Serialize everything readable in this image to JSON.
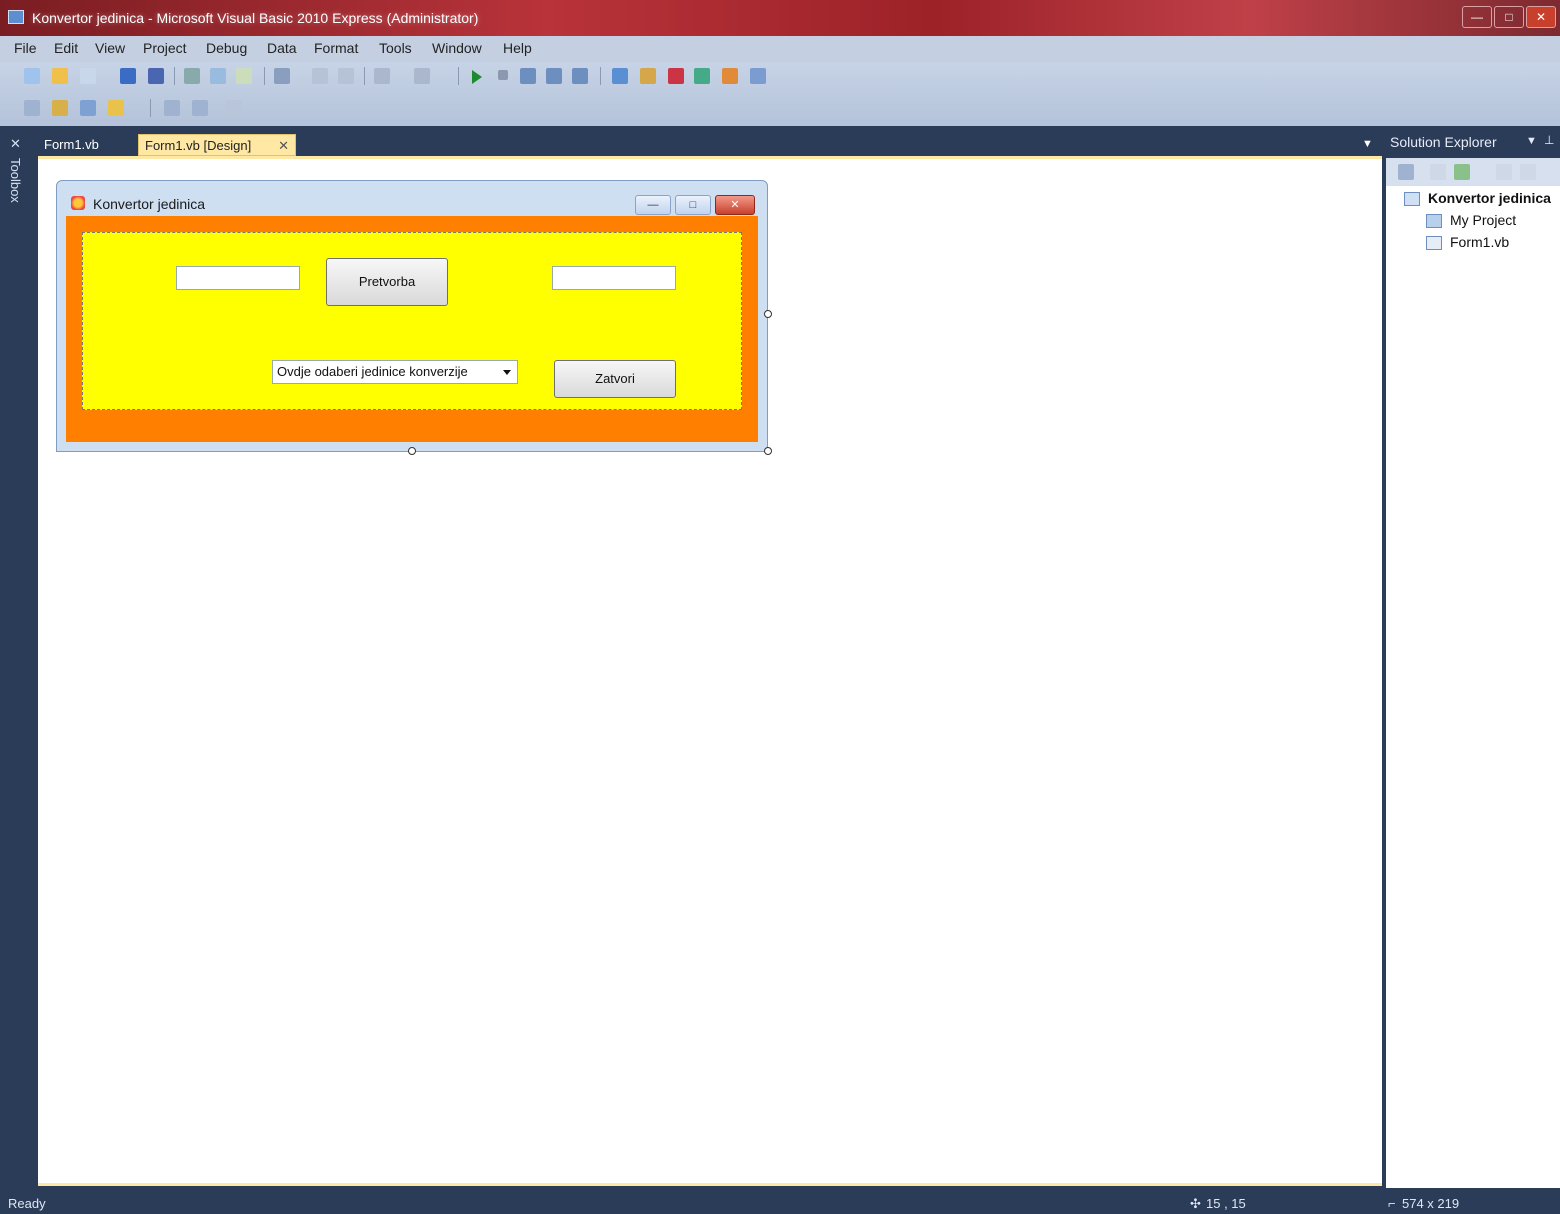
{
  "window": {
    "title": "Konvertor jedinica - Microsoft Visual Basic 2010 Express (Administrator)"
  },
  "menu": [
    "File",
    "Edit",
    "View",
    "Project",
    "Debug",
    "Data",
    "Format",
    "Tools",
    "Window",
    "Help"
  ],
  "toolbox": {
    "label": "Toolbox"
  },
  "tabs": {
    "code": "Form1.vb",
    "design": "Form1.vb [Design]",
    "close": "✕"
  },
  "form": {
    "title": "Konvertor jedinica",
    "convert_button": "Pretvorba",
    "close_button": "Zatvori",
    "combo_text": "Ovdje odaberi jedinice konverzije",
    "colors": {
      "client": "#ff8000",
      "panel": "#ffff00"
    }
  },
  "solution_explorer": {
    "title": "Solution Explorer",
    "root": "Konvertor jedinica",
    "items": [
      "My Project",
      "Form1.vb"
    ]
  },
  "status": {
    "left": "Ready",
    "position": "15 , 15",
    "size": "574 x 219"
  }
}
